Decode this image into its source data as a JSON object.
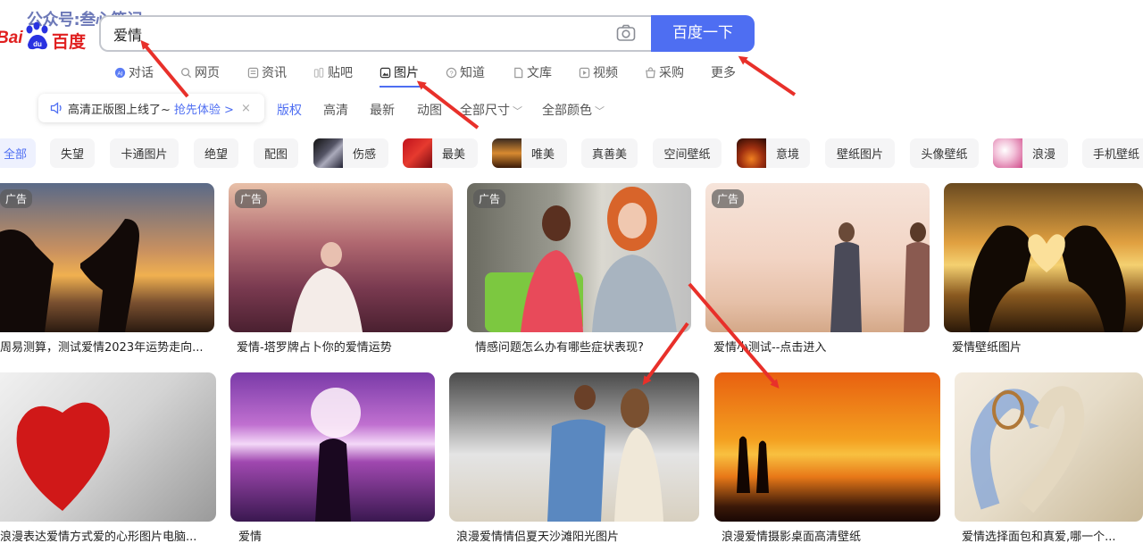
{
  "watermark": "公众号:叁心笔记",
  "logo": {
    "bai": "Bai",
    "du": "du",
    "cn": "百度"
  },
  "search": {
    "value": "爱情",
    "button_label": "百度一下"
  },
  "nav": {
    "items": [
      {
        "label": "对话",
        "icon": "chat-ai-icon"
      },
      {
        "label": "网页",
        "icon": "search-icon"
      },
      {
        "label": "资讯",
        "icon": "news-icon"
      },
      {
        "label": "贴吧",
        "icon": "tieba-icon"
      },
      {
        "label": "图片",
        "icon": "image-icon",
        "active": true
      },
      {
        "label": "知道",
        "icon": "question-icon"
      },
      {
        "label": "文库",
        "icon": "document-icon"
      },
      {
        "label": "视频",
        "icon": "video-icon"
      },
      {
        "label": "采购",
        "icon": "shopping-icon"
      },
      {
        "label": "更多"
      }
    ]
  },
  "notice": {
    "text": "高清正版图上线了~",
    "link": "抢先体验 >",
    "close": "×"
  },
  "filters": [
    {
      "label": "版权"
    },
    {
      "label": "高清"
    },
    {
      "label": "最新"
    },
    {
      "label": "动图"
    },
    {
      "label": "全部尺寸",
      "dropdown": true
    },
    {
      "label": "全部颜色",
      "dropdown": true
    }
  ],
  "chips": [
    {
      "label": "全部",
      "active": true
    },
    {
      "label": "失望"
    },
    {
      "label": "卡通图片"
    },
    {
      "label": "绝望"
    },
    {
      "label": "配图"
    },
    {
      "label": "伤感"
    },
    {
      "label": "最美"
    },
    {
      "label": "唯美"
    },
    {
      "label": "真善美"
    },
    {
      "label": "空间壁纸"
    },
    {
      "label": "意境"
    },
    {
      "label": "壁纸图片"
    },
    {
      "label": "头像壁纸"
    },
    {
      "label": "浪漫"
    },
    {
      "label": "手机壁纸"
    }
  ],
  "images": [
    {
      "caption": "周易测算，测试爱情2023年运势走向...",
      "ad": "广告"
    },
    {
      "caption": "爱情-塔罗牌占卜你的爱情运势",
      "ad": "广告"
    },
    {
      "caption": "情感问题怎么办有哪些症状表现?",
      "ad": "广告"
    },
    {
      "caption": "爱情小测试--点击进入",
      "ad": "广告"
    },
    {
      "caption": "爱情壁纸图片"
    },
    {
      "caption": "浪漫表达爱情方式爱的心形图片电脑..."
    },
    {
      "caption": "爱情"
    },
    {
      "caption": "浪漫爱情情侣夏天沙滩阳光图片"
    },
    {
      "caption": "浪漫爱情摄影桌面高清壁纸"
    },
    {
      "caption": "爱情选择面包和真爱,哪一个..."
    }
  ],
  "colors": {
    "accent": "#4e6ef2",
    "logo_red": "#e02020",
    "arrow": "#e8302a"
  }
}
